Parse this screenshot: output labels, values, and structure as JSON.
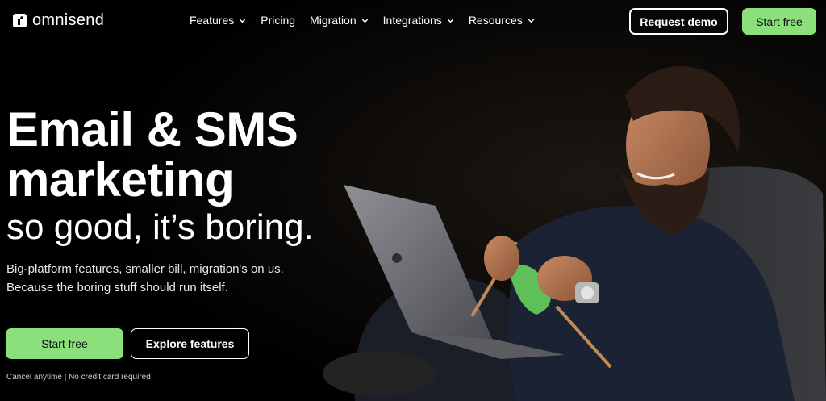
{
  "brand": {
    "name": "omnisend",
    "logo_icon": "omnisend-logo-icon"
  },
  "nav": {
    "items": [
      {
        "label": "Features",
        "has_dropdown": true
      },
      {
        "label": "Pricing",
        "has_dropdown": false
      },
      {
        "label": "Migration",
        "has_dropdown": true
      },
      {
        "label": "Integrations",
        "has_dropdown": true
      },
      {
        "label": "Resources",
        "has_dropdown": true
      }
    ],
    "request_demo_label": "Request demo",
    "start_free_label": "Start free"
  },
  "hero": {
    "headline_line1": "Email & SMS",
    "headline_line2": "marketing",
    "headline_line3": "so good, it’s boring.",
    "subtext_line1": "Big-platform features, smaller bill, migration's on us.",
    "subtext_line2": "Because the boring stuff should run itself.",
    "cta_primary": "Start free",
    "cta_secondary": "Explore features",
    "fineprint": "Cancel anytime | No credit card required"
  },
  "colors": {
    "accent_green": "#8ce07c",
    "background": "#000000",
    "text": "#ffffff"
  }
}
